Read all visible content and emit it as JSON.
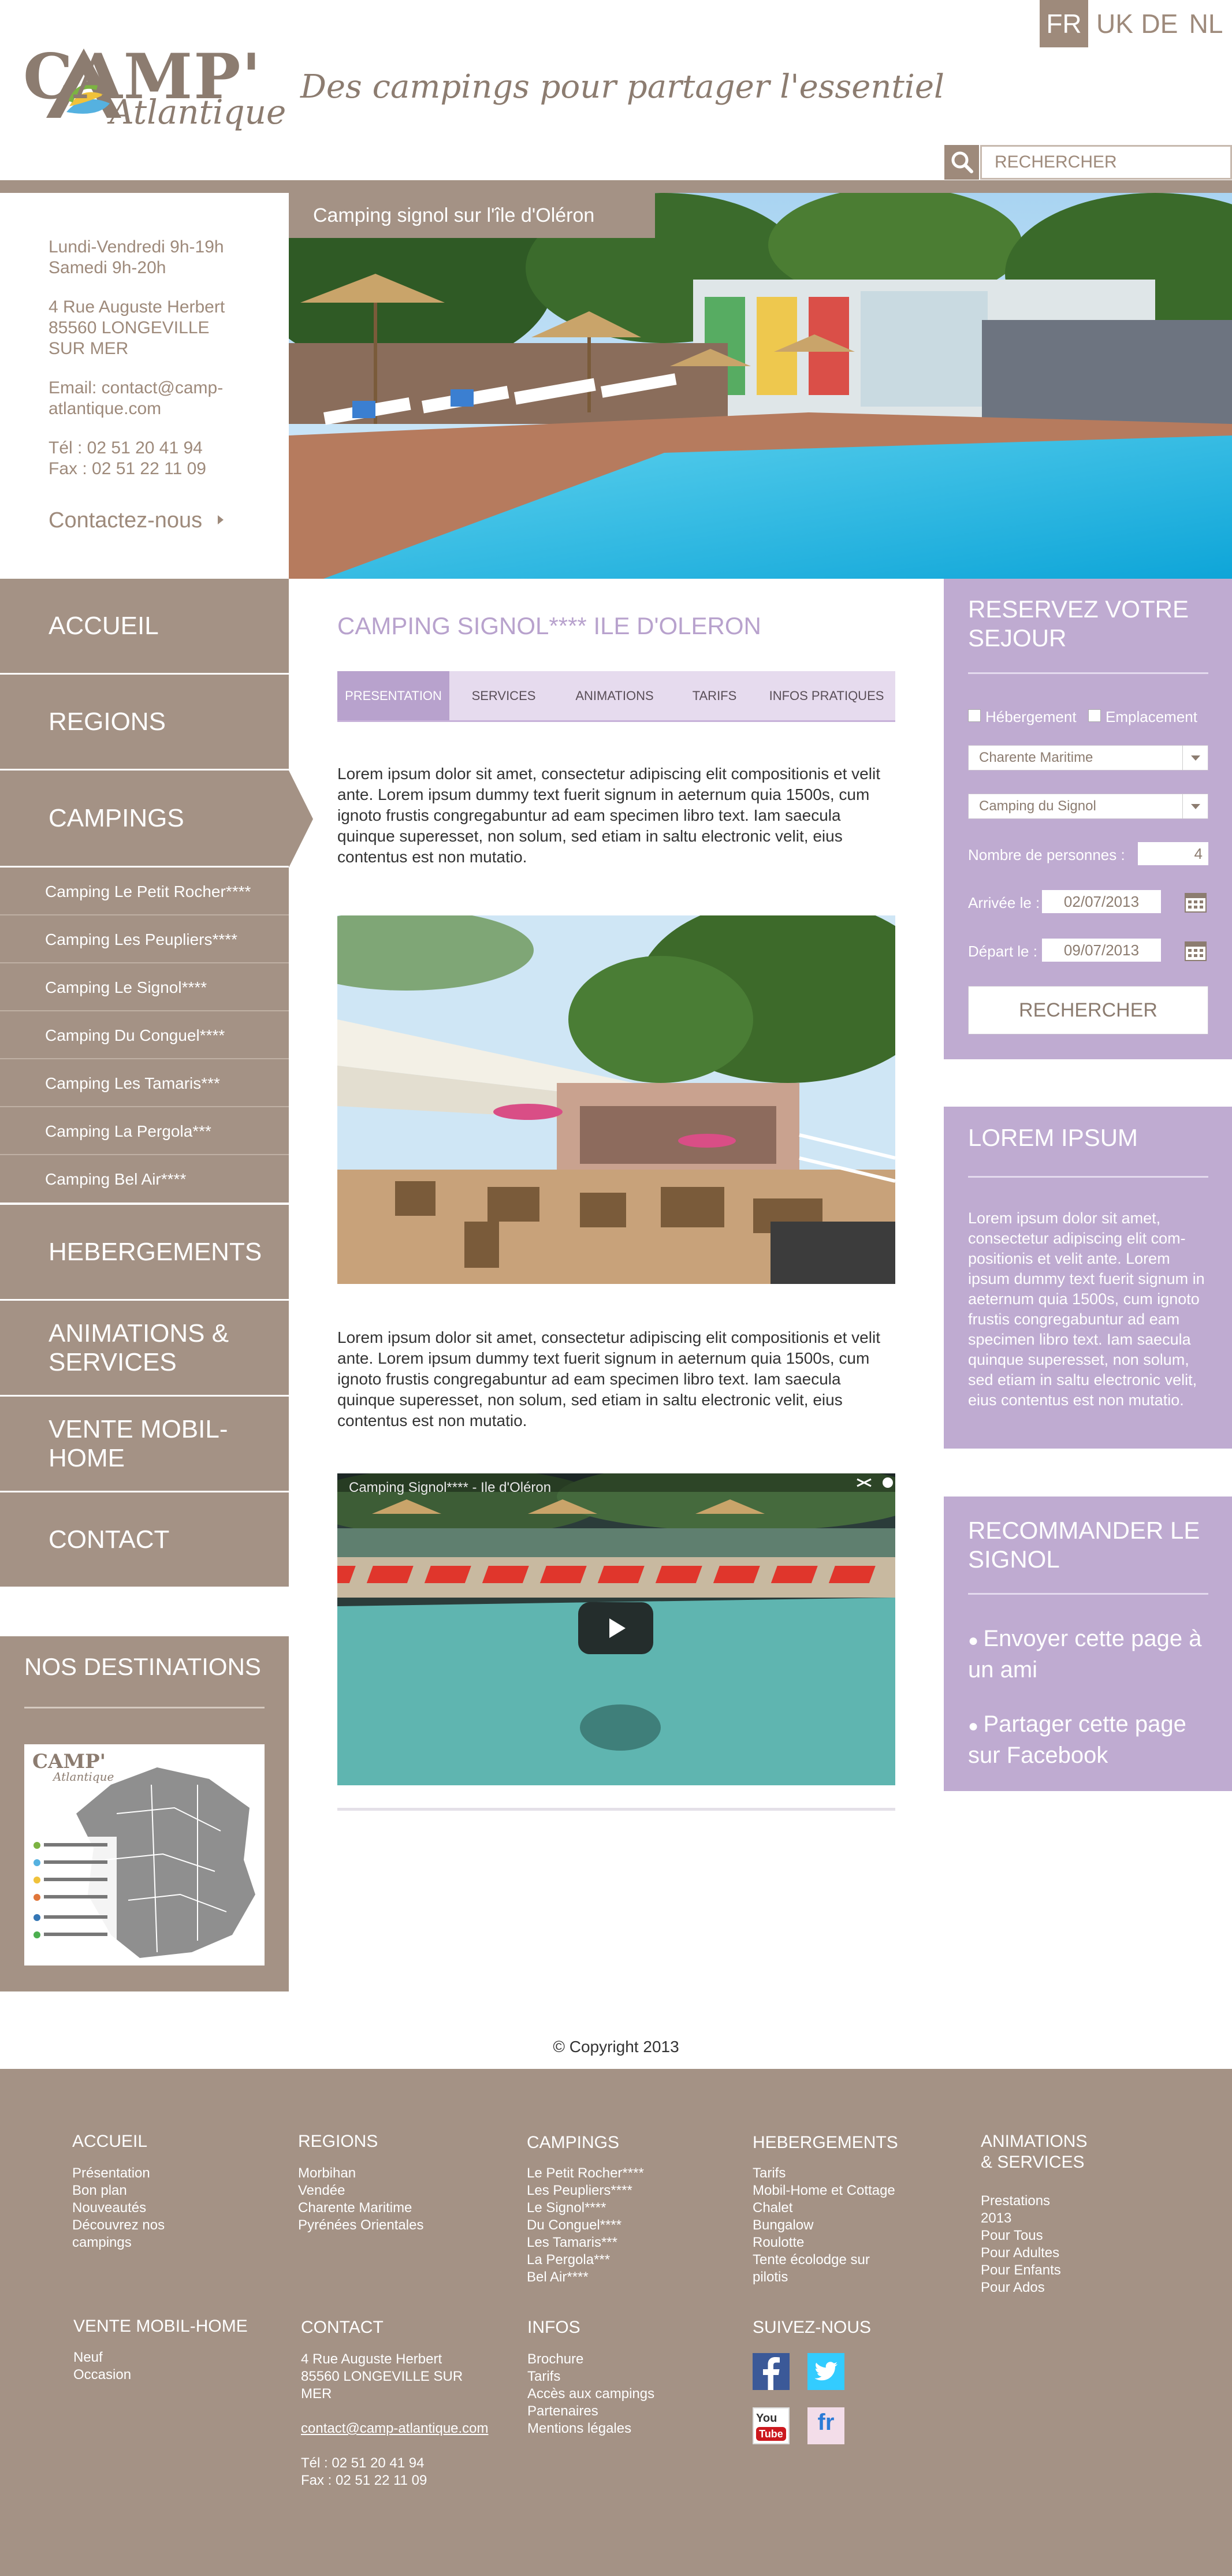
{
  "header": {
    "languages": [
      {
        "label": "FR",
        "active": true
      },
      {
        "label": "UK",
        "active": false
      },
      {
        "label": "DE",
        "active": false
      },
      {
        "label": "NL",
        "active": false
      }
    ],
    "logo_text": "CAMP'",
    "logo_sub": "Atlantique",
    "tagline": "Des campings pour partager l'essentiel",
    "search_placeholder": "RECHERCHER"
  },
  "info": {
    "hours_1": "Lundi-Vendredi 9h-19h",
    "hours_2": "Samedi 9h-20h",
    "address_1": "4 Rue Auguste Herbert",
    "address_2": "85560 LONGEVILLE",
    "address_3": "SUR MER",
    "email_1": "Email: contact@camp-",
    "email_2": "atlantique.com",
    "tel": "Tél : 02 51 20 41 94",
    "fax": "Fax : 02 51 22 11 09",
    "contact_link": "Contactez-nous"
  },
  "hero": {
    "caption": "Camping signol sur l'île d'Oléron"
  },
  "nav": {
    "items": [
      "ACCUEIL",
      "REGIONS",
      "CAMPINGS",
      "HEBERGEMENTS",
      "ANIMATIONS & SERVICES",
      "VENTE MOBIL-HOME",
      "CONTACT"
    ],
    "sub_items": [
      "Camping Le Petit Rocher****",
      "Camping Les Peupliers****",
      "Camping Le Signol****",
      "Camping Du Conguel****",
      "Camping Les Tamaris***",
      "Camping La Pergola***",
      "Camping Bel Air****"
    ]
  },
  "destinations": {
    "title": "NOS DESTINATIONS",
    "map_logo": "CAMP'",
    "map_logo_sub": "Atlantique"
  },
  "main": {
    "title": "CAMPING SIGNOL****  ILE D'OLERON",
    "tabs": [
      "PRESENTATION",
      "SERVICES",
      "ANIMATIONS",
      "TARIFS",
      "INFOS PRATIQUES"
    ],
    "paragraph": "Lorem ipsum dolor sit amet, consectetur adipiscing elit compositionis et velit ante. Lorem ipsum dummy text fuerit signum in aeternum quia 1500s, cum ignoto frustis congregabuntur ad eam specimen libro text. Iam saecula quinque superesset, non solum, sed etiam in saltu electronic velit, eius contentus est non mutatio.",
    "video_title": "Camping Signol**** - Ile d'Oléron"
  },
  "reserve": {
    "title_1": "RESERVEZ VOTRE",
    "title_2": "SEJOUR",
    "check_hebergement": "Hébergement",
    "check_emplacement": "Emplacement",
    "region_value": "Charente Maritime",
    "camping_value": "Camping du Signol",
    "persons_label": "Nombre de personnes :",
    "persons_value": "4",
    "arrival_label": "Arrivée le :",
    "arrival_value": "02/07/2013",
    "departure_label": "Départ le :",
    "departure_value": "09/07/2013",
    "search_button": "RECHERCHER"
  },
  "lorem_widget": {
    "title": "LOREM IPSUM",
    "text": "Lorem ipsum dolor sit amet, consectetur adipiscing elit com-positionis et velit ante. Lorem ipsum dummy text fuerit signum in aeternum quia 1500s, cum ignoto frustis congregabuntur ad eam specimen libro text. Iam saecula quinque superesset, non solum, sed etiam in saltu electronic velit, eius contentus est non mutatio."
  },
  "recommend": {
    "title_1": "RECOMMANDER LE",
    "title_2": "SIGNOL",
    "bullet_1": "Envoyer cette page à un ami",
    "bullet_2_prefix": "Partager cette page sur ",
    "bullet_2_link": "Facebook"
  },
  "copyright": "© Copyright 2013",
  "footer": {
    "accueil": {
      "title": "ACCUEIL",
      "items": [
        "Présentation",
        "Bon plan",
        "Nouveautés",
        "Découvrez nos",
        "campings"
      ]
    },
    "regions": {
      "title": "REGIONS",
      "items": [
        "Morbihan",
        "Vendée",
        "Charente Maritime",
        "Pyrénées Orientales"
      ]
    },
    "campings": {
      "title": "CAMPINGS",
      "items": [
        "Le Petit Rocher****",
        "Les Peupliers****",
        "Le Signol****",
        "Du Conguel****",
        "Les Tamaris***",
        "La Pergola***",
        "Bel Air****"
      ]
    },
    "hebergements": {
      "title": "HEBERGEMENTS",
      "items": [
        "Tarifs",
        "Mobil-Home et Cottage",
        "Chalet",
        "Bungalow",
        "Roulotte",
        "Tente écolodge sur",
        "pilotis"
      ]
    },
    "animations": {
      "title_1": "ANIMATIONS",
      "title_2": "& SERVICES",
      "items": [
        "Prestations",
        "2013",
        "Pour Tous",
        "Pour Adultes",
        "Pour Enfants",
        "Pour Ados"
      ]
    },
    "vente": {
      "title": "VENTE MOBIL-HOME",
      "items": [
        "Neuf",
        "Occasion"
      ]
    },
    "contact": {
      "title": "CONTACT",
      "address_1": "4 Rue Auguste Herbert",
      "address_2": "85560 LONGEVILLE SUR",
      "address_3": "MER",
      "email": "contact@camp-atlantique.com",
      "tel": "Tél : 02 51 20 41 94",
      "fax": "Fax : 02 51 22 11 09"
    },
    "infos": {
      "title": "INFOS",
      "items": [
        "Brochure",
        "Tarifs",
        "Accès aux campings",
        "Partenaires",
        "Mentions légales"
      ]
    },
    "suivez": {
      "title": "SUIVEZ-NOUS",
      "youtube_you": "You",
      "youtube_tube": "Tube",
      "fr_label": "fr"
    }
  },
  "colors": {
    "brand_taupe": "#a49285",
    "accent_lilac": "#bfabd1",
    "title_lilac": "#b8a2cd"
  }
}
